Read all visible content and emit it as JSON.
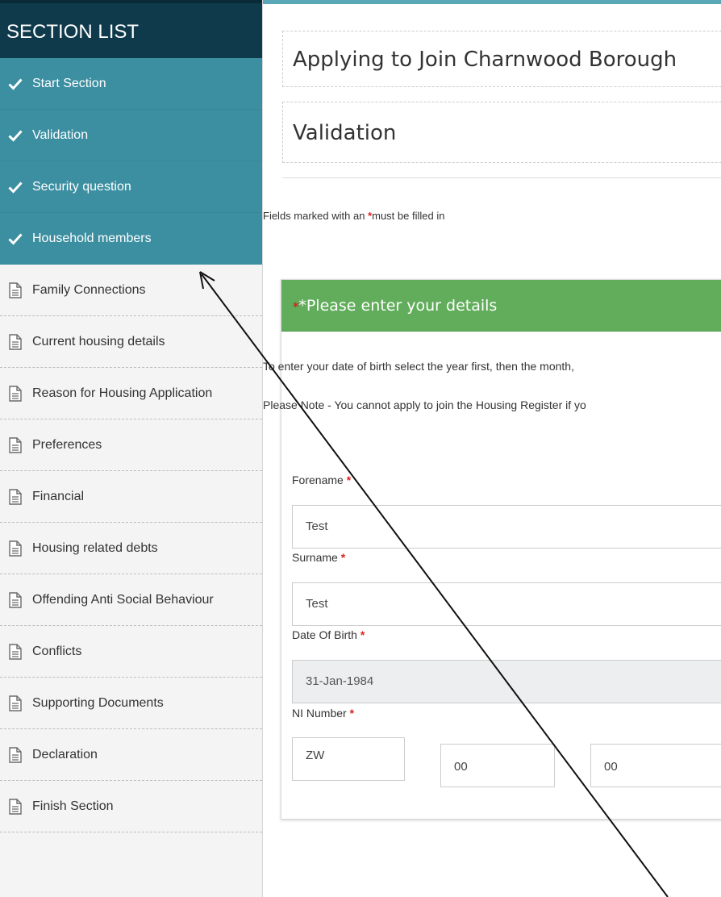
{
  "sidebar": {
    "title": "SECTION LIST",
    "completed_items": [
      {
        "label": "Start Section",
        "icon": "check-icon"
      },
      {
        "label": "Validation",
        "icon": "check-icon"
      },
      {
        "label": "Security question",
        "icon": "check-icon"
      },
      {
        "label": "Household members",
        "icon": "check-icon"
      }
    ],
    "pending_items": [
      {
        "label": "Family Connections",
        "icon": "document-icon"
      },
      {
        "label": "Current housing details",
        "icon": "document-icon"
      },
      {
        "label": "Reason for Housing Application",
        "icon": "document-icon"
      },
      {
        "label": "Preferences",
        "icon": "document-icon"
      },
      {
        "label": "Financial",
        "icon": "document-icon"
      },
      {
        "label": "Housing related debts",
        "icon": "document-icon"
      },
      {
        "label": "Offending Anti Social Behaviour",
        "icon": "document-icon"
      },
      {
        "label": "Conflicts",
        "icon": "document-icon"
      },
      {
        "label": "Supporting Documents",
        "icon": "document-icon"
      },
      {
        "label": "Declaration",
        "icon": "document-icon"
      },
      {
        "label": "Finish Section",
        "icon": "document-icon"
      }
    ]
  },
  "main": {
    "app_title": "Applying to Join Charnwood Borough",
    "section_title": "Validation",
    "required_note_prefix": "Fields marked with an ",
    "required_note_suffix": "must be filled in",
    "required_star": "*",
    "panel": {
      "title": "*Please enter your details",
      "instruction_1": "To enter your date of birth select the year first, then the month,",
      "instruction_2": "Please Note - You cannot apply to join the Housing Register if yo"
    },
    "fields": {
      "forename": {
        "label": "Forename",
        "value": "Test"
      },
      "surname": {
        "label": "Surname",
        "value": "Test"
      },
      "dob": {
        "label": "Date Of Birth",
        "value": "31-Jan-1984"
      },
      "ni": {
        "label": "NI Number",
        "part1": "ZW",
        "part2": "00",
        "part3": "00"
      }
    }
  },
  "colors": {
    "sidebar_header": "#0f3a4b",
    "completed_section": "#3c8fa1",
    "panel_header": "#61ad5b",
    "required_star": "#e02020"
  }
}
